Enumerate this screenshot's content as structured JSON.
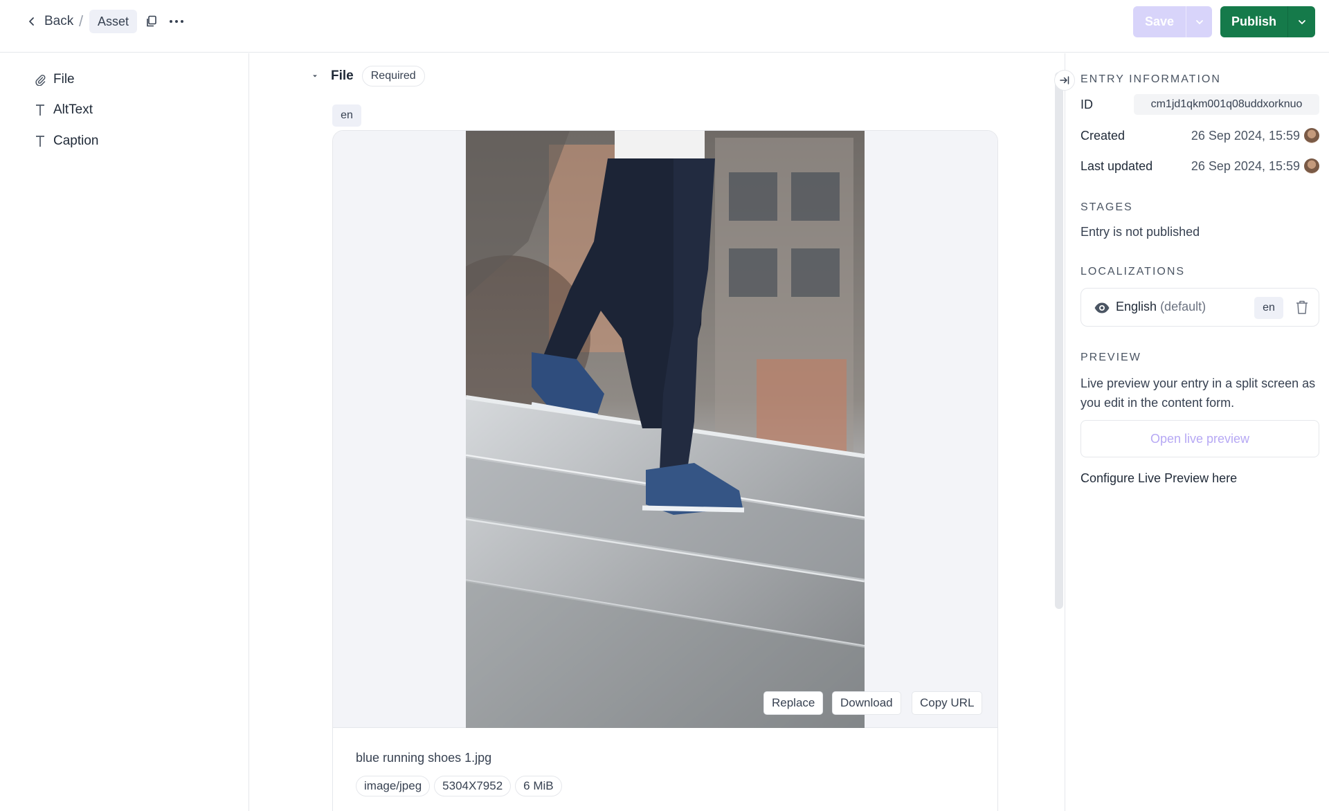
{
  "toolbar": {
    "back_label": "Back",
    "breadcrumb_separator": "/",
    "breadcrumb_current": "Asset",
    "save_label": "Save",
    "publish_label": "Publish"
  },
  "sidebar": {
    "items": [
      {
        "label": "File",
        "icon": "paperclip-icon"
      },
      {
        "label": "AltText",
        "icon": "text-icon"
      },
      {
        "label": "Caption",
        "icon": "text-icon"
      }
    ]
  },
  "field": {
    "title": "File",
    "required_label": "Required",
    "locale": "en"
  },
  "asset": {
    "actions": {
      "replace": "Replace",
      "download": "Download",
      "copy_url": "Copy URL"
    },
    "file_name": "blue running shoes 1.jpg",
    "meta": [
      "image/jpeg",
      "5304X7952",
      "6 MiB"
    ]
  },
  "entry_info": {
    "heading": "ENTRY INFORMATION",
    "id_label": "ID",
    "id_value": "cm1jd1qkm001q08uddxorknuo",
    "created_label": "Created",
    "created_value": "26 Sep 2024, 15:59",
    "updated_label": "Last updated",
    "updated_value": "26 Sep 2024, 15:59"
  },
  "stages": {
    "heading": "STAGES",
    "status": "Entry is not published"
  },
  "localizations": {
    "heading": "LOCALIZATIONS",
    "language": "English",
    "default_suffix": "(default)",
    "code": "en"
  },
  "preview": {
    "heading": "PREVIEW",
    "description": "Live preview your entry in a split screen as you edit in the content form.",
    "button_label": "Open live preview",
    "configure_label": "Configure Live Preview here"
  },
  "colors": {
    "publish": "#157a4a",
    "save_disabled": "#d8d4fa",
    "link_disabled": "#b6a8f4"
  }
}
